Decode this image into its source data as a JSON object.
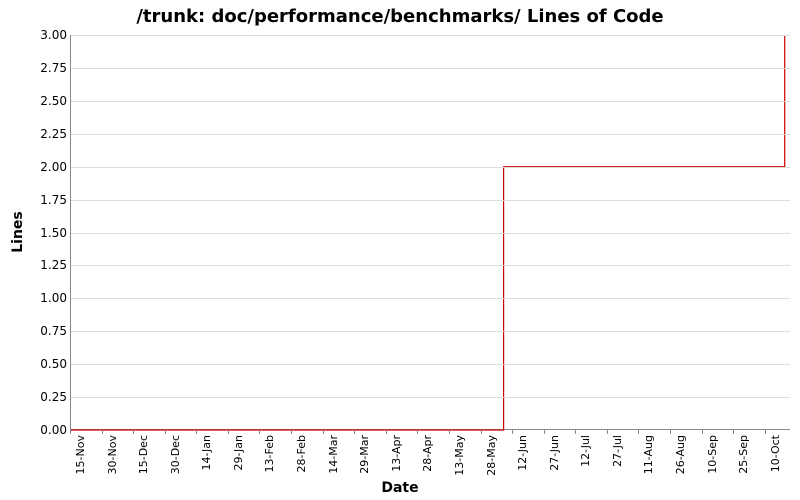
{
  "chart_data": {
    "type": "line",
    "title": "/trunk: doc/performance/benchmarks/ Lines of Code",
    "xlabel": "Date",
    "ylabel": "Lines",
    "ylim": [
      0,
      3
    ],
    "y_ticks": [
      "0.00",
      "0.25",
      "0.50",
      "0.75",
      "1.00",
      "1.25",
      "1.50",
      "1.75",
      "2.00",
      "2.25",
      "2.50",
      "2.75",
      "3.00"
    ],
    "x_ticks": [
      "15-Nov",
      "30-Nov",
      "15-Dec",
      "30-Dec",
      "14-Jan",
      "29-Jan",
      "13-Feb",
      "28-Feb",
      "14-Mar",
      "29-Mar",
      "13-Apr",
      "28-Apr",
      "13-May",
      "28-May",
      "12-Jun",
      "27-Jun",
      "12-Jul",
      "27-Jul",
      "11-Aug",
      "26-Aug",
      "10-Sep",
      "25-Sep",
      "10-Oct"
    ],
    "series": [
      {
        "name": "Lines of Code",
        "color": "#cc0000",
        "points": [
          {
            "x_index": 0,
            "y": 0
          },
          {
            "x_index": 13.7,
            "y": 0
          },
          {
            "x_index": 13.7,
            "y": 2
          },
          {
            "x_index": 22.6,
            "y": 2
          },
          {
            "x_index": 22.6,
            "y": 3
          }
        ]
      }
    ],
    "x_extent_index": 22.8
  }
}
